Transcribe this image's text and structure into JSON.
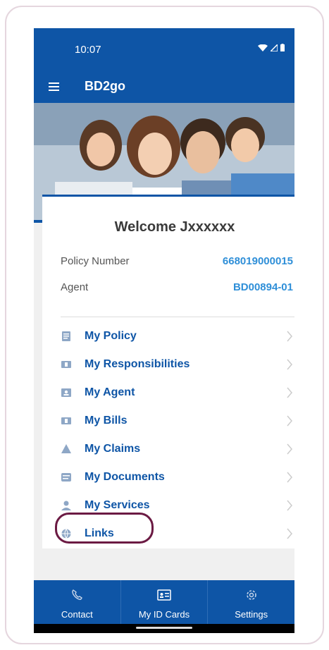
{
  "status_bar": {
    "time": "10:07"
  },
  "app_bar": {
    "title": "BD2go"
  },
  "welcome": "Welcome Jxxxxxx",
  "policy": {
    "policy_label": "Policy Number",
    "policy_value": "668019000015",
    "agent_label": "Agent",
    "agent_value": "BD00894-01"
  },
  "menu": [
    {
      "label": "My Policy",
      "icon": "document-icon"
    },
    {
      "label": "My Responsibilities",
      "icon": "money-icon"
    },
    {
      "label": "My Agent",
      "icon": "person-card-icon"
    },
    {
      "label": "My Bills",
      "icon": "money-icon"
    },
    {
      "label": "My Claims",
      "icon": "warning-icon"
    },
    {
      "label": "My Documents",
      "icon": "documents-icon"
    },
    {
      "label": "My Services",
      "icon": "person-icon"
    },
    {
      "label": "Links",
      "icon": "globe-icon"
    }
  ],
  "tabs": [
    {
      "label": "Contact",
      "icon": "phone-icon"
    },
    {
      "label": "My ID Cards",
      "icon": "id-card-icon"
    },
    {
      "label": "Settings",
      "icon": "gear-icon"
    }
  ],
  "colors": {
    "brand_blue": "#0e55a6",
    "value_blue": "#2f8fd8",
    "highlight_ring": "#6b1a43",
    "icon_grey_blue": "#8ea7c6"
  }
}
